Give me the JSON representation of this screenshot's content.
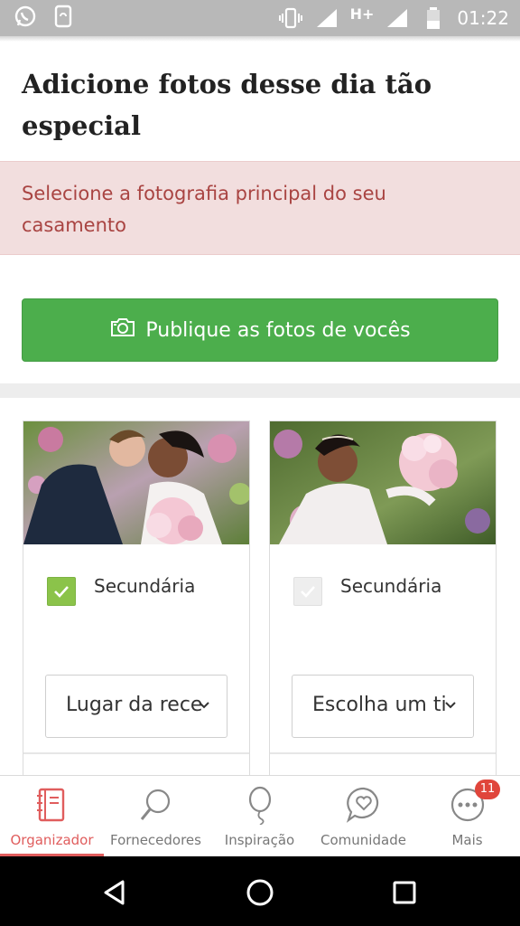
{
  "status_bar": {
    "time": "01:22",
    "network": "H+"
  },
  "page": {
    "title": "Adicione fotos desse dia tão especial",
    "alert": "Selecione a fotografia principal do seu casamento",
    "publish_button": "Publique as fotos de vocês"
  },
  "photos": [
    {
      "checkbox_label": "Secundária",
      "checked": true,
      "select_value": "Lugar da rece"
    },
    {
      "checkbox_label": "Secundária",
      "checked": false,
      "select_value": "Escolha um ti"
    }
  ],
  "bottom_nav": {
    "items": [
      {
        "label": "Organizador",
        "icon": "organizer-book-icon",
        "active": true
      },
      {
        "label": "Fornecedores",
        "icon": "magnifier-icon"
      },
      {
        "label": "Inspiração",
        "icon": "balloon-icon"
      },
      {
        "label": "Comunidade",
        "icon": "chat-heart-icon"
      },
      {
        "label": "Mais",
        "icon": "more-dots-icon",
        "badge": "11"
      }
    ]
  },
  "colors": {
    "accent": "#e05d5d",
    "success": "#4cae4c",
    "alert_bg": "#f2dede",
    "alert_text": "#a94442",
    "check": "#8bc34a"
  }
}
